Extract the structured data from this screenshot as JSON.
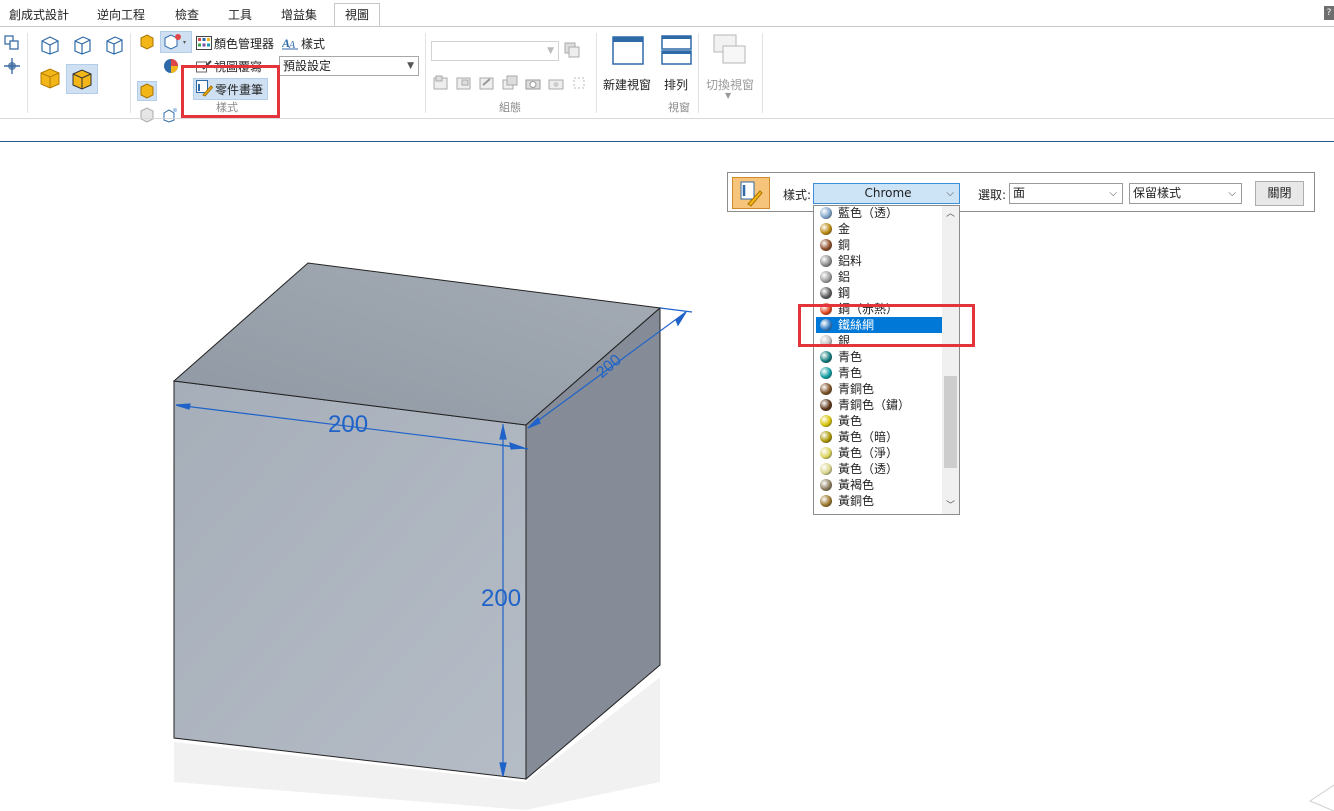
{
  "tabs": [
    {
      "label": "創成式設計",
      "active": false
    },
    {
      "label": "逆向工程",
      "active": false
    },
    {
      "label": "檢查",
      "active": false
    },
    {
      "label": "工具",
      "active": false
    },
    {
      "label": "增益集",
      "active": false
    },
    {
      "label": "視圖",
      "active": true
    }
  ],
  "ribbon": {
    "style_group": {
      "color_manager": "顏色管理器",
      "styles": "樣式",
      "view_override": "視圖覆寫",
      "part_painter": "零件畫筆",
      "default_setting": "預設設定",
      "label": "樣式"
    },
    "assembly_group": {
      "label": "組態",
      "combo_value": ""
    },
    "window_group": {
      "new_window": "新建視窗",
      "arrange": "排列",
      "switch_window": "切換視窗",
      "label": "視窗"
    }
  },
  "part_painter_bar": {
    "style_label": "樣式:",
    "style_value": "Chrome",
    "select_label": "選取:",
    "select_value": "面",
    "keep_value": "保留樣式",
    "close_label": "關閉"
  },
  "style_list": [
    {
      "label": "藍色（透）",
      "color": "#7ea3c9"
    },
    {
      "label": "金",
      "color": "#b8860b"
    },
    {
      "label": "銅",
      "color": "#8b4a24"
    },
    {
      "label": "鋁料",
      "color": "#8a8a8a"
    },
    {
      "label": "鋁",
      "color": "#9a9a9a"
    },
    {
      "label": "鋼",
      "color": "#5a5a5a"
    },
    {
      "label": "鋼（赤熱）",
      "color": "#e0441c"
    },
    {
      "label": "鐵絲網",
      "color": "#3a7fc1",
      "selected": true
    },
    {
      "label": "銀",
      "color": "#c0c0c0"
    },
    {
      "label": "青色",
      "color": "#0f7a7a"
    },
    {
      "label": "青色",
      "color": "#0e9ba0"
    },
    {
      "label": "青銅色",
      "color": "#7a4d22"
    },
    {
      "label": "青銅色（鏽）",
      "color": "#5a3316"
    },
    {
      "label": "黃色",
      "color": "#d6c200"
    },
    {
      "label": "黃色（暗）",
      "color": "#a89600"
    },
    {
      "label": "黃色（淨）",
      "color": "#d9d35a"
    },
    {
      "label": "黃色（透）",
      "color": "#d8d48a"
    },
    {
      "label": "黃褐色",
      "color": "#8a7a5a"
    },
    {
      "label": "黃銅色",
      "color": "#9a7426"
    }
  ],
  "model": {
    "dim_width": "200",
    "dim_height": "200",
    "dim_depth": "200"
  }
}
